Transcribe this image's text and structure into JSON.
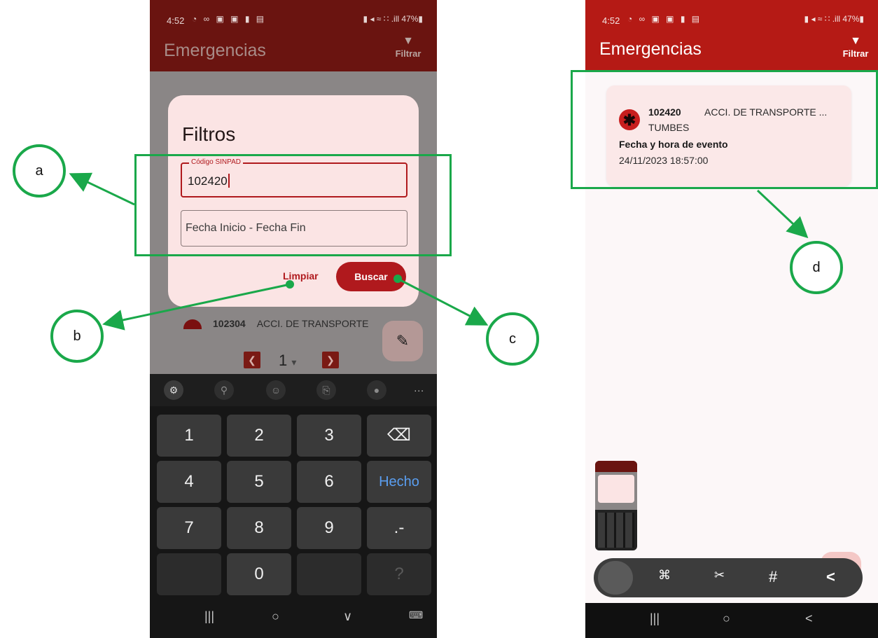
{
  "status_bar": {
    "time": "4:52",
    "left_icons": "◔ ∞ ▣ ▣ ▮ ▤",
    "right_icons": "▮ ◂ ≈ ∷ .ill 47%▮",
    "battery": "47%"
  },
  "app": {
    "title": "Emergencias",
    "filter_label": "Filtrar",
    "filter_icon": "filter-icon"
  },
  "filter_dialog": {
    "title": "Filtros",
    "code_field": {
      "label": "Código SINPAD",
      "value": "102420"
    },
    "date_field": {
      "placeholder": "Fecha Inicio - Fecha Fin"
    },
    "clear_label": "Limpiar",
    "search_label": "Buscar"
  },
  "behind_list": {
    "peek_code": "102304",
    "peek_type": "ACCI. DE TRANSPORTE"
  },
  "pager": {
    "page": "1",
    "dropdown": "▾"
  },
  "keyboard": {
    "toolbar": [
      "settings-icon",
      "search-icon",
      "emoji-icon",
      "clipboard-icon",
      "mic-icon"
    ],
    "more": "...",
    "rows": [
      [
        "1",
        "2",
        "3",
        "⌫"
      ],
      [
        "4",
        "5",
        "6",
        "Hecho"
      ],
      [
        "7",
        "8",
        "9",
        ".-"
      ],
      [
        "",
        "0",
        "?"
      ]
    ]
  },
  "nav_left": {
    "recents": "|||",
    "home": "○",
    "back": "∨",
    "kbd": "⌨"
  },
  "result_card": {
    "code": "102420",
    "type": "ACCI. DE TRANSPORTE ...",
    "place": "TUMBES",
    "date_label": "Fecha y hora de evento",
    "date_value": "24/11/2023 18:57:00"
  },
  "screenshot_toolbar": [
    "scan-icon",
    "edit-crop-icon",
    "hashtag-icon",
    "share-icon"
  ],
  "screenshot_toolbar_glyphs": [
    "⌘",
    "✂",
    "#",
    "<"
  ],
  "nav_right": {
    "recents": "|||",
    "home": "○",
    "back": "<"
  },
  "annotations": [
    "a",
    "b",
    "c",
    "d"
  ],
  "colors": {
    "accent": "#b51a15",
    "dark_appbar": "#6a1410",
    "annotation": "#1aa84a",
    "dialog_bg": "#fbe4e4",
    "key_blue": "#5a9ef0"
  }
}
